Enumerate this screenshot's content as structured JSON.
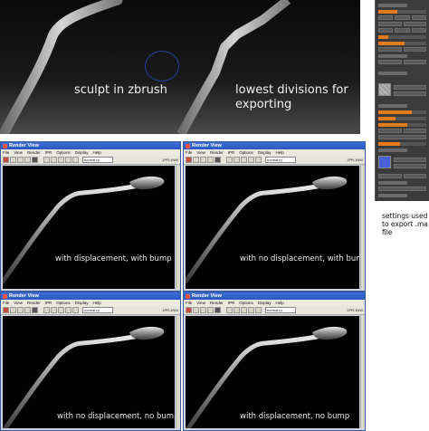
{
  "top_image": {
    "caption_left": "sculpt in zbrush",
    "caption_right_line1": "lowest divisions for",
    "caption_right_line2": "exporting"
  },
  "side_note": "settings used to export .ma file",
  "render_windows": [
    {
      "title": "Render View",
      "menu": [
        "File",
        "View",
        "Render",
        "IPR",
        "Options",
        "Display",
        "Help"
      ],
      "camera_select": "normal rp",
      "info": "1PR:1NW",
      "caption": "with displacement, with bump"
    },
    {
      "title": "Render View",
      "menu": [
        "File",
        "View",
        "Render",
        "IPR",
        "Options",
        "Display",
        "Help"
      ],
      "camera_select": "normal rp",
      "info": "1PR:1NW",
      "caption": "with no displacement, with bump"
    },
    {
      "title": "Render View",
      "menu": [
        "File",
        "View",
        "Render",
        "IPR",
        "Options",
        "Display",
        "Help"
      ],
      "camera_select": "normal rp",
      "info": "1PR:1NW",
      "caption": "with no displacement, no bump"
    },
    {
      "title": "Render View",
      "menu": [
        "File",
        "View",
        "Render",
        "IPR",
        "Options",
        "Display",
        "Help"
      ],
      "camera_select": "normal rp",
      "info": "1PR:1NW",
      "caption": "with displacement, no bump"
    }
  ],
  "colors": {
    "zbrush_slider": "#e27b1c",
    "titlebar": "#2a58c0",
    "viewport_bg": "#020202"
  }
}
